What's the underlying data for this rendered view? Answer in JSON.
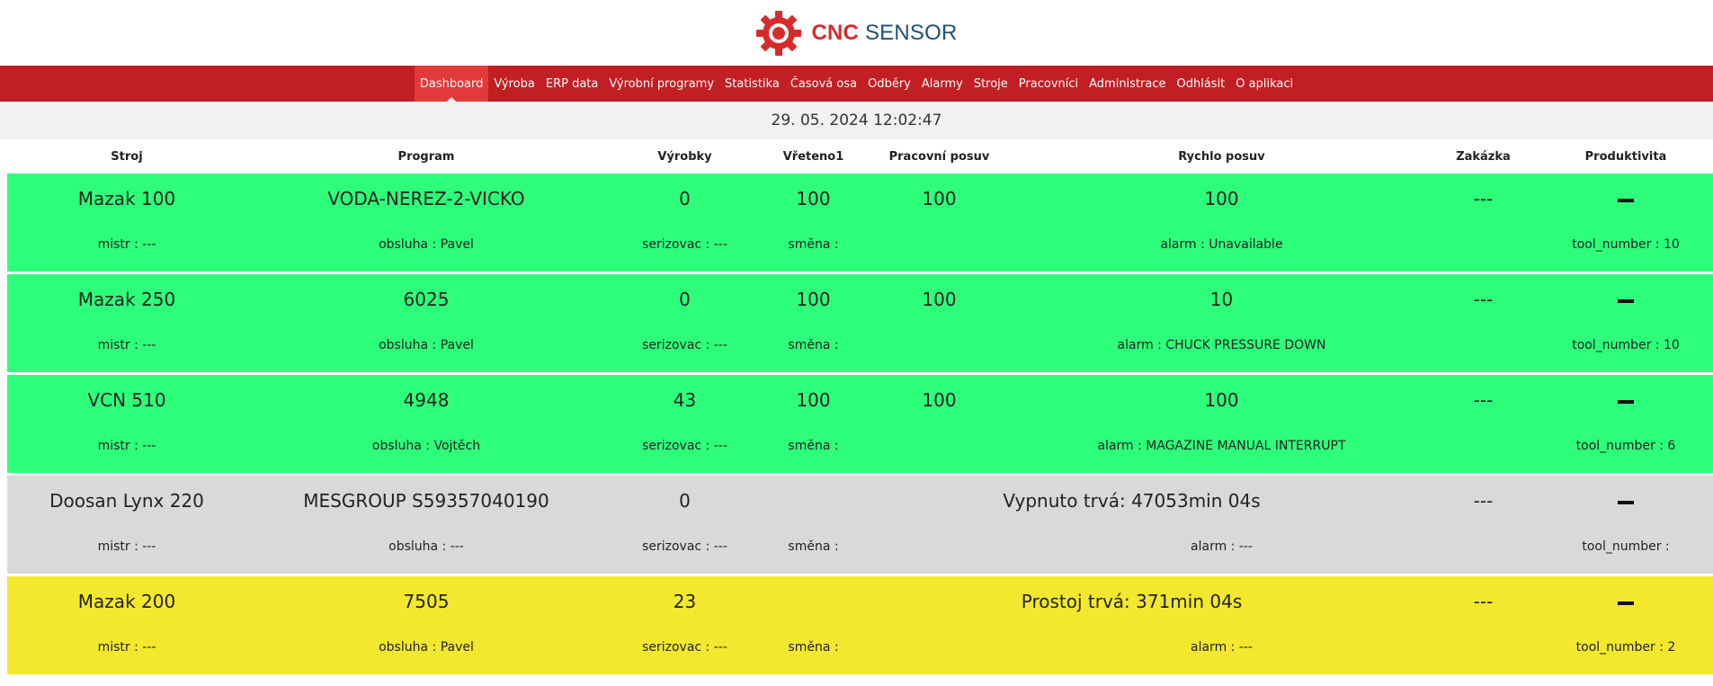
{
  "logo": {
    "cnc": "CNC",
    "sensor": "SENSOR"
  },
  "nav": [
    {
      "label": "Dashboard",
      "active": true
    },
    {
      "label": "Výroba"
    },
    {
      "label": "ERP data"
    },
    {
      "label": "Výrobní programy"
    },
    {
      "label": "Statistika"
    },
    {
      "label": "Časová osa"
    },
    {
      "label": "Odběry"
    },
    {
      "label": "Alarmy"
    },
    {
      "label": "Stroje"
    },
    {
      "label": "Pracovníci"
    },
    {
      "label": "Administrace"
    },
    {
      "label": "Odhlásit"
    },
    {
      "label": "O aplikaci"
    }
  ],
  "datetime": "29. 05. 2024 12:02:47",
  "columns": [
    "Stroj",
    "Program",
    "Výrobky",
    "Vřeteno1",
    "Pracovní posuv",
    "Rychlo posuv",
    "Zakázka",
    "Produktivita"
  ],
  "colors": {
    "green": "#2eff7a",
    "grey": "#d9d9d9",
    "yellow": "#f3e82e",
    "nav": "#c11f24"
  },
  "rows": [
    {
      "status": "green",
      "machine": "Mazak 100",
      "program": "VODA-NEREZ-2-VICKO",
      "vyrobky": "0",
      "vreteno": "100",
      "pracovni": "100",
      "rychlo": "100",
      "zakazka": "---",
      "mistr": "mistr : ---",
      "obsluha": "obsluha : Pavel",
      "serizovac": "serizovac : ---",
      "smena": "směna :",
      "alarm": "alarm : Unavailable",
      "tool": "tool_number : 10"
    },
    {
      "status": "green",
      "machine": "Mazak 250",
      "program": "6025",
      "vyrobky": "0",
      "vreteno": "100",
      "pracovni": "100",
      "rychlo": "10",
      "zakazka": "---",
      "mistr": "mistr : ---",
      "obsluha": "obsluha : Pavel",
      "serizovac": "serizovac : ---",
      "smena": "směna :",
      "alarm": "alarm : CHUCK PRESSURE DOWN",
      "tool": "tool_number : 10"
    },
    {
      "status": "green",
      "machine": "VCN 510",
      "program": "4948",
      "vyrobky": "43",
      "vreteno": "100",
      "pracovni": "100",
      "rychlo": "100",
      "zakazka": "---",
      "mistr": "mistr : ---",
      "obsluha": "obsluha : Vojtěch",
      "serizovac": "serizovac : ---",
      "smena": "směna :",
      "alarm": "alarm : MAGAZINE MANUAL INTERRUPT",
      "tool": "tool_number : 6"
    },
    {
      "status": "grey",
      "machine": "Doosan Lynx 220",
      "program": "MESGROUP S59357040190",
      "vyrobky": "0",
      "message": "Vypnuto trvá: 47053min 04s",
      "zakazka": "---",
      "mistr": "mistr : ---",
      "obsluha": "obsluha : ---",
      "serizovac": "serizovac : ---",
      "smena": "směna :",
      "alarm": "alarm : ---",
      "tool": "tool_number :"
    },
    {
      "status": "yellow",
      "machine": "Mazak 200",
      "program": "7505",
      "vyrobky": "23",
      "message": "Prostoj trvá: 371min 04s",
      "zakazka": "---",
      "mistr": "mistr : ---",
      "obsluha": "obsluha : Pavel",
      "serizovac": "serizovac : ---",
      "smena": "směna :",
      "alarm": "alarm : ---",
      "tool": "tool_number : 2"
    }
  ]
}
